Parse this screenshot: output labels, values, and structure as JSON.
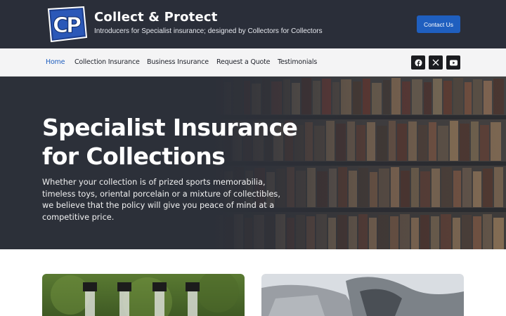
{
  "header": {
    "logo_text": "CP",
    "brand_title": "Collect & Protect",
    "tagline": "Introducers for Specialist insurance; designed by Collectors for Collectors",
    "contact_label": "Contact Us"
  },
  "nav": {
    "items": [
      {
        "label": "Home",
        "active": true
      },
      {
        "label": "Collection Insurance",
        "active": false
      },
      {
        "label": "Business Insurance",
        "active": false
      },
      {
        "label": "Request a Quote",
        "active": false
      },
      {
        "label": "Testimonials",
        "active": false
      }
    ],
    "social": [
      "facebook-icon",
      "x-icon",
      "youtube-icon"
    ]
  },
  "hero": {
    "title": "Specialist Insurance for Collections",
    "text": "Whether your collection is of prized sports memorabilia, timeless toys, oriental porcelain or a mixture of collectibles, we believe that the policy will give you peace of mind at a competitive price."
  },
  "colors": {
    "header_bg": "#2a2e39",
    "accent": "#1f5fbf",
    "nav_bg": "#f4f4f5"
  }
}
